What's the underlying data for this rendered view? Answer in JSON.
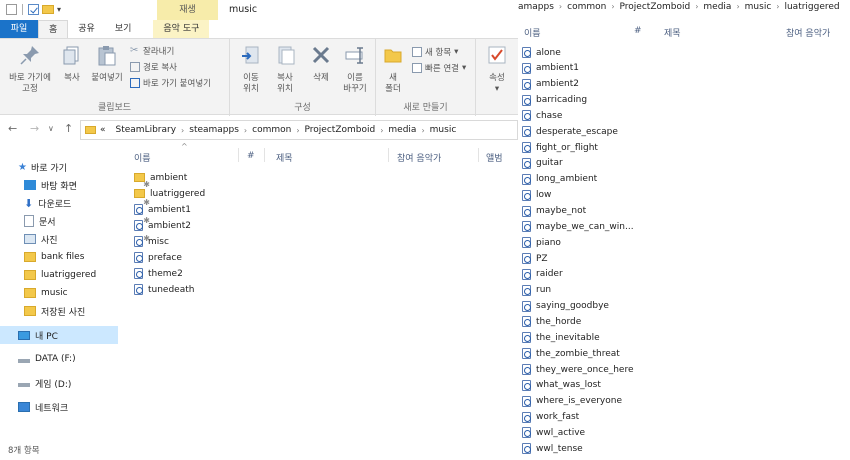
{
  "window": {
    "title": "music",
    "context_tab_group": "재생"
  },
  "ribbon_tabs": [
    "파일",
    "홈",
    "공유",
    "보기",
    "음악 도구"
  ],
  "ribbon": {
    "clipboard": {
      "label": "클립보드",
      "pin_label_1": "바로 가기에",
      "pin_label_2": "고정",
      "copy": "복사",
      "paste": "붙여넣기",
      "cut": "잘라내기",
      "copy_path": "경로 복사",
      "paste_shortcut": "바로 가기 붙여넣기"
    },
    "organize": {
      "label": "구성",
      "move_1": "이동",
      "move_2": "위치",
      "copy_1": "복사",
      "copy_2": "위치",
      "delete": "삭제",
      "rename_1": "이름",
      "rename_2": "바꾸기"
    },
    "new": {
      "label": "새로 만들기",
      "new_folder_1": "새",
      "new_folder_2": "폴더",
      "new_item": "새 항목",
      "easy_access": "빠른 연결"
    },
    "open": {
      "properties": "속성"
    }
  },
  "address": {
    "overflow": "«",
    "crumbs": [
      "SteamLibrary",
      "steamapps",
      "common",
      "ProjectZomboid",
      "media",
      "music"
    ]
  },
  "nav": {
    "quick_access": "바로 가기",
    "desktop": "바탕 화면",
    "downloads": "다운로드",
    "documents": "문서",
    "pictures": "사진",
    "bank_files": "bank files",
    "luatriggered": "luatriggered",
    "music": "music",
    "saved_pictures": "저장된 사진",
    "this_pc": "내 PC",
    "data_drive": "DATA (F:)",
    "game_drive": "게임 (D:)",
    "network": "네트워크"
  },
  "columns": {
    "name": "이름",
    "number": "#",
    "title": "제목",
    "artists": "참여 음악가",
    "album": "앨범"
  },
  "files": [
    {
      "name": "ambient",
      "type": "folder"
    },
    {
      "name": "luatriggered",
      "type": "folder"
    },
    {
      "name": "ambient1",
      "type": "file"
    },
    {
      "name": "ambient2",
      "type": "file"
    },
    {
      "name": "misc",
      "type": "file"
    },
    {
      "name": "preface",
      "type": "file"
    },
    {
      "name": "theme2",
      "type": "file"
    },
    {
      "name": "tunedeath",
      "type": "file"
    }
  ],
  "status": {
    "item_count": "8개 항목"
  },
  "pane2": {
    "crumbs": [
      "amapps",
      "common",
      "ProjectZomboid",
      "media",
      "music",
      "luatriggered"
    ],
    "columns": {
      "name": "이름",
      "number": "#",
      "title": "제목",
      "artists": "참여 음악가"
    },
    "files": [
      "alone",
      "ambient1",
      "ambient2",
      "barricading",
      "chase",
      "desperate_escape",
      "fight_or_flight",
      "guitar",
      "long_ambient",
      "low",
      "maybe_not",
      "maybe_we_can_win...",
      "piano",
      "PZ",
      "raider",
      "run",
      "saying_goodbye",
      "the_horde",
      "the_inevitable",
      "the_zombie_threat",
      "they_were_once_here",
      "what_was_lost",
      "where_is_everyone",
      "work_fast",
      "wwl_active",
      "wwl_tense"
    ]
  }
}
